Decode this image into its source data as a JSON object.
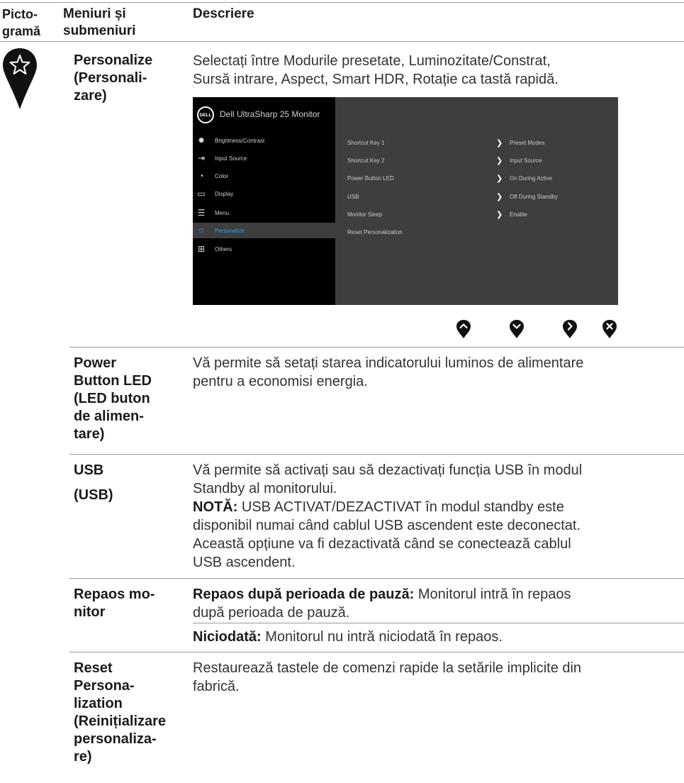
{
  "header": {
    "col1": [
      "Picto-",
      "gramă"
    ],
    "col2": [
      "Meniuri și",
      "submeniuri"
    ],
    "col3": "Descriere"
  },
  "rows": {
    "personalize": {
      "name": [
        "Personalize",
        "(Personali-",
        "zare)"
      ],
      "desc": [
        "Selectați între Modurile presetate, Luminozitate/Constrat,",
        "Sursă intrare, Aspect, Smart HDR, Rotație ca tastă rapidă."
      ]
    },
    "power_led": {
      "name": [
        "Power",
        "Button LED",
        "(LED buton",
        "de alimen-",
        "tare)"
      ],
      "desc": [
        "Vă permite să setați starea indicatorului luminos de alimentare",
        "pentru a economisi energia."
      ]
    },
    "usb": {
      "name": [
        "USB",
        "(USB)"
      ],
      "desc": [
        "Vă permite să activați sau să dezactivați funcția USB în modul",
        "Standby al monitorului."
      ],
      "note_label": "NOTĂ:",
      "note": [
        " USB ACTIVAT/DEZACTIVAT în modul standby este",
        "disponibil numai când cablul USB ascendent este deconectat.",
        "Această opțiune va fi dezactivată când se conectează cablul",
        "USB ascendent."
      ]
    },
    "sleep": {
      "name": [
        "Repaos mo-",
        "nitor"
      ],
      "opt1_label": "Repaos după perioada de pauză:",
      "opt1_text": [
        " Monitorul intră în repaos",
        "după perioada de pauză."
      ],
      "opt2_label": "Niciodată:",
      "opt2_text": " Monitorul nu intră niciodată în repaos."
    },
    "reset": {
      "name": [
        "Reset",
        "Persona-",
        "lization",
        "(Reinițializare",
        "personaliza-",
        "re)"
      ],
      "desc": [
        "Restaurează tastele de comenzi rapide la setările implicite din",
        "fabrică."
      ]
    }
  },
  "osd": {
    "logo": "DELL",
    "title": "Dell UltraSharp 25 Monitor",
    "menu": [
      {
        "label": "Brightness/Contrast",
        "icon": "brightness-icon"
      },
      {
        "label": "Input Source",
        "icon": "input-source-icon"
      },
      {
        "label": "Color",
        "icon": "color-icon"
      },
      {
        "label": "Display",
        "icon": "display-icon"
      },
      {
        "label": "Menu",
        "icon": "menu-icon"
      },
      {
        "label": "Personalize",
        "icon": "star-icon",
        "active": true
      },
      {
        "label": "Others",
        "icon": "others-icon"
      }
    ],
    "options": [
      {
        "key": "Shortcut Key 1",
        "value": "Preset Modes"
      },
      {
        "key": "Shortcut Key 2",
        "value": "Input Source"
      },
      {
        "key": "Power Button LED",
        "value": "On During Active"
      },
      {
        "key": "USB",
        "value": "Off During Standby"
      },
      {
        "key": "Monitor Sleep",
        "value": "Enable"
      },
      {
        "key": "Reset Personalization",
        "value": ""
      }
    ]
  },
  "colors": {
    "accent": "#2ea1e8",
    "osd_left": "#000000",
    "osd_right": "#3e3e3e",
    "rule": "#9a9a9a"
  },
  "nav_icons": [
    "up-icon",
    "down-icon",
    "right-icon",
    "close-icon"
  ]
}
